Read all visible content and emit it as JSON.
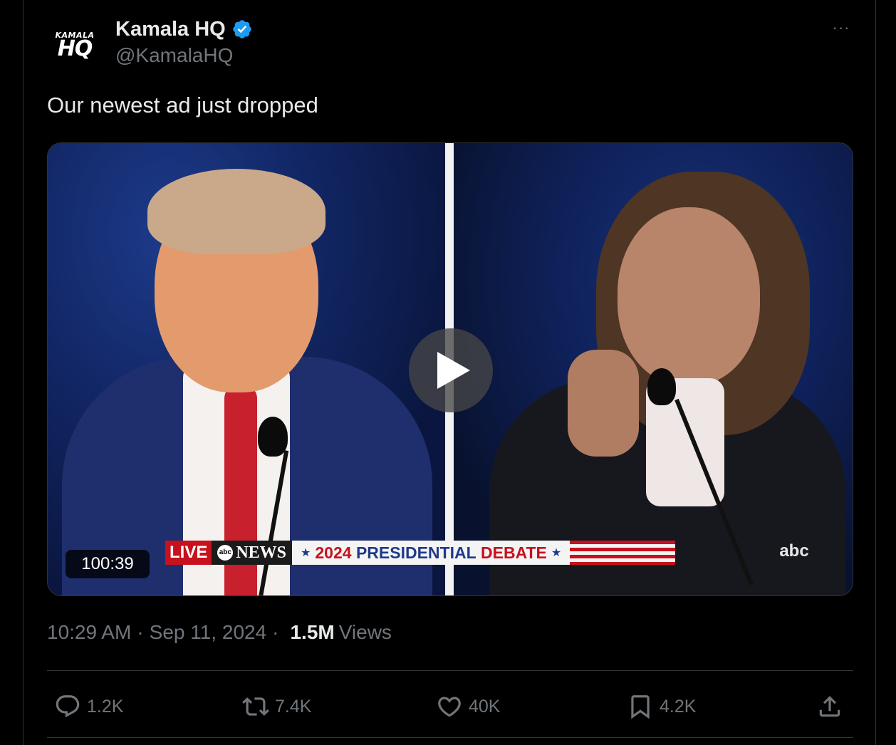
{
  "author": {
    "avatar_line1": "KAMALA",
    "avatar_line2": "HQ",
    "display_name": "Kamala HQ",
    "handle": "@KamalaHQ",
    "verified_color": "#1d9bf0"
  },
  "more_label": "···",
  "tweet": {
    "text": "Our newest ad just dropped"
  },
  "video": {
    "duration": "100:39",
    "banner": {
      "live": "LIVE",
      "network_badge": "abc",
      "network": "NEWS",
      "star": "★",
      "title_year": "2024",
      "title_mid": "PRESIDENTIAL",
      "title_end": "DEBATE"
    },
    "channel_logo": "abc",
    "play_icon": "play-icon"
  },
  "meta": {
    "time": "10:29 AM",
    "separator": "·",
    "date": "Sep 11, 2024",
    "views_count": "1.5M",
    "views_label": "Views"
  },
  "actions": {
    "replies": "1.2K",
    "reposts": "7.4K",
    "likes": "40K",
    "bookmarks": "4.2K"
  },
  "colors": {
    "background": "#000000",
    "text_primary": "#e7e9ea",
    "text_secondary": "#71767b",
    "border": "#2f3336"
  }
}
